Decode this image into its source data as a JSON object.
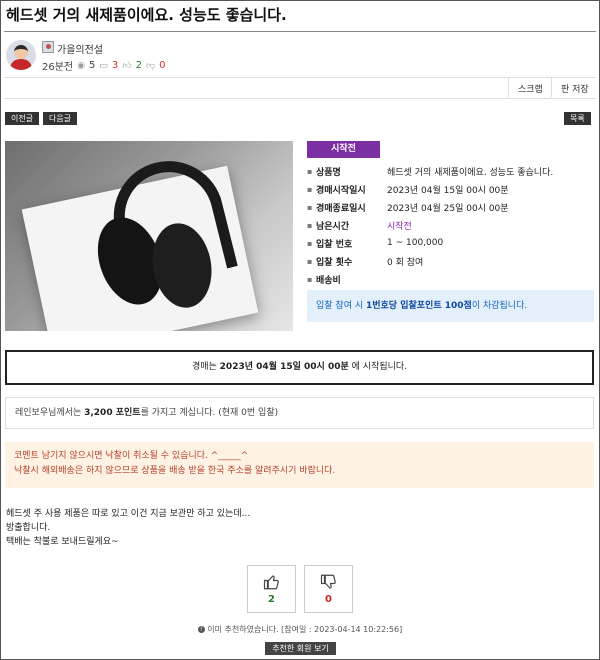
{
  "post": {
    "title": "헤드셋 거의 새제품이에요. 성능도 좋습니다."
  },
  "author": {
    "name": "가을의전설",
    "time_ago": "26분전",
    "views": "5",
    "comments": "3",
    "likes": "2",
    "dislikes": "0"
  },
  "toolbar": {
    "scrap_label": "스크랩",
    "save_label": "판 저장"
  },
  "nav": {
    "prev_label": "이전글",
    "next_label": "다음글",
    "list_label": "목록"
  },
  "auction": {
    "badge": "시작전",
    "rows": [
      {
        "label": "상품명",
        "value": "헤드셋 거의 새제품이에요. 성능도 좋습니다."
      },
      {
        "label": "경매시작일시",
        "value": "2023년 04월 15일 00시 00분"
      },
      {
        "label": "경매종료일시",
        "value": "2023년 04월 25일 00시 00분"
      },
      {
        "label": "남은시간",
        "value": "시작전"
      },
      {
        "label": "입찰 번호",
        "value": "1 ~ 100,000"
      },
      {
        "label": "입찰 횟수",
        "value": "0 회 참여"
      },
      {
        "label": "배송비",
        "value": ""
      }
    ],
    "notice_pre": "입찰 참여 시 ",
    "notice_bold": "1번호당 입찰포인트 100점",
    "notice_post": "이 차감됩니다.",
    "start_pre": "경매는 ",
    "start_bold": "2023년 04월 15일 00시 00분",
    "start_post": " 에 시작됩니다."
  },
  "points": {
    "pre": "레인보우님께서는 ",
    "bold": "3,200 포인트",
    "post": "를 가지고 계십니다. (현재 0번 입찰)"
  },
  "warning": {
    "line1": "코멘트 남기지 않으시면 낙찰이 취소될 수 있습니다. ^_____^",
    "line2": "낙찰시 해외배송은 하지 않으므로 상품을 배송 받을 한국 주소를 알려주시기 바랍니다."
  },
  "content": {
    "line1": "헤드셋 주 사용 제품은 따로 있고 이건 지금 보관만 하고 있는데...",
    "line2": "방출합니다.",
    "line3": "택배는 착불로 보내드릴게요~"
  },
  "votes": {
    "up": "2",
    "down": "0",
    "recommended_notice": "이미 추천하였습니다. [참여일 : 2023-04-14 10:22:56]",
    "view_recommenders_label": "추천한 회원 보기"
  },
  "icons": {
    "views": "eye-icon",
    "comments": "comment-icon",
    "likes": "thumbs-up-icon",
    "dislikes": "thumbs-down-icon"
  },
  "colors": {
    "badge": "#7b2fa2",
    "notice_bg": "#e3effa",
    "warning_bg": "#fdf2e4",
    "warning_text": "#b8412a",
    "up": "#2e7d32",
    "down": "#c62828"
  }
}
